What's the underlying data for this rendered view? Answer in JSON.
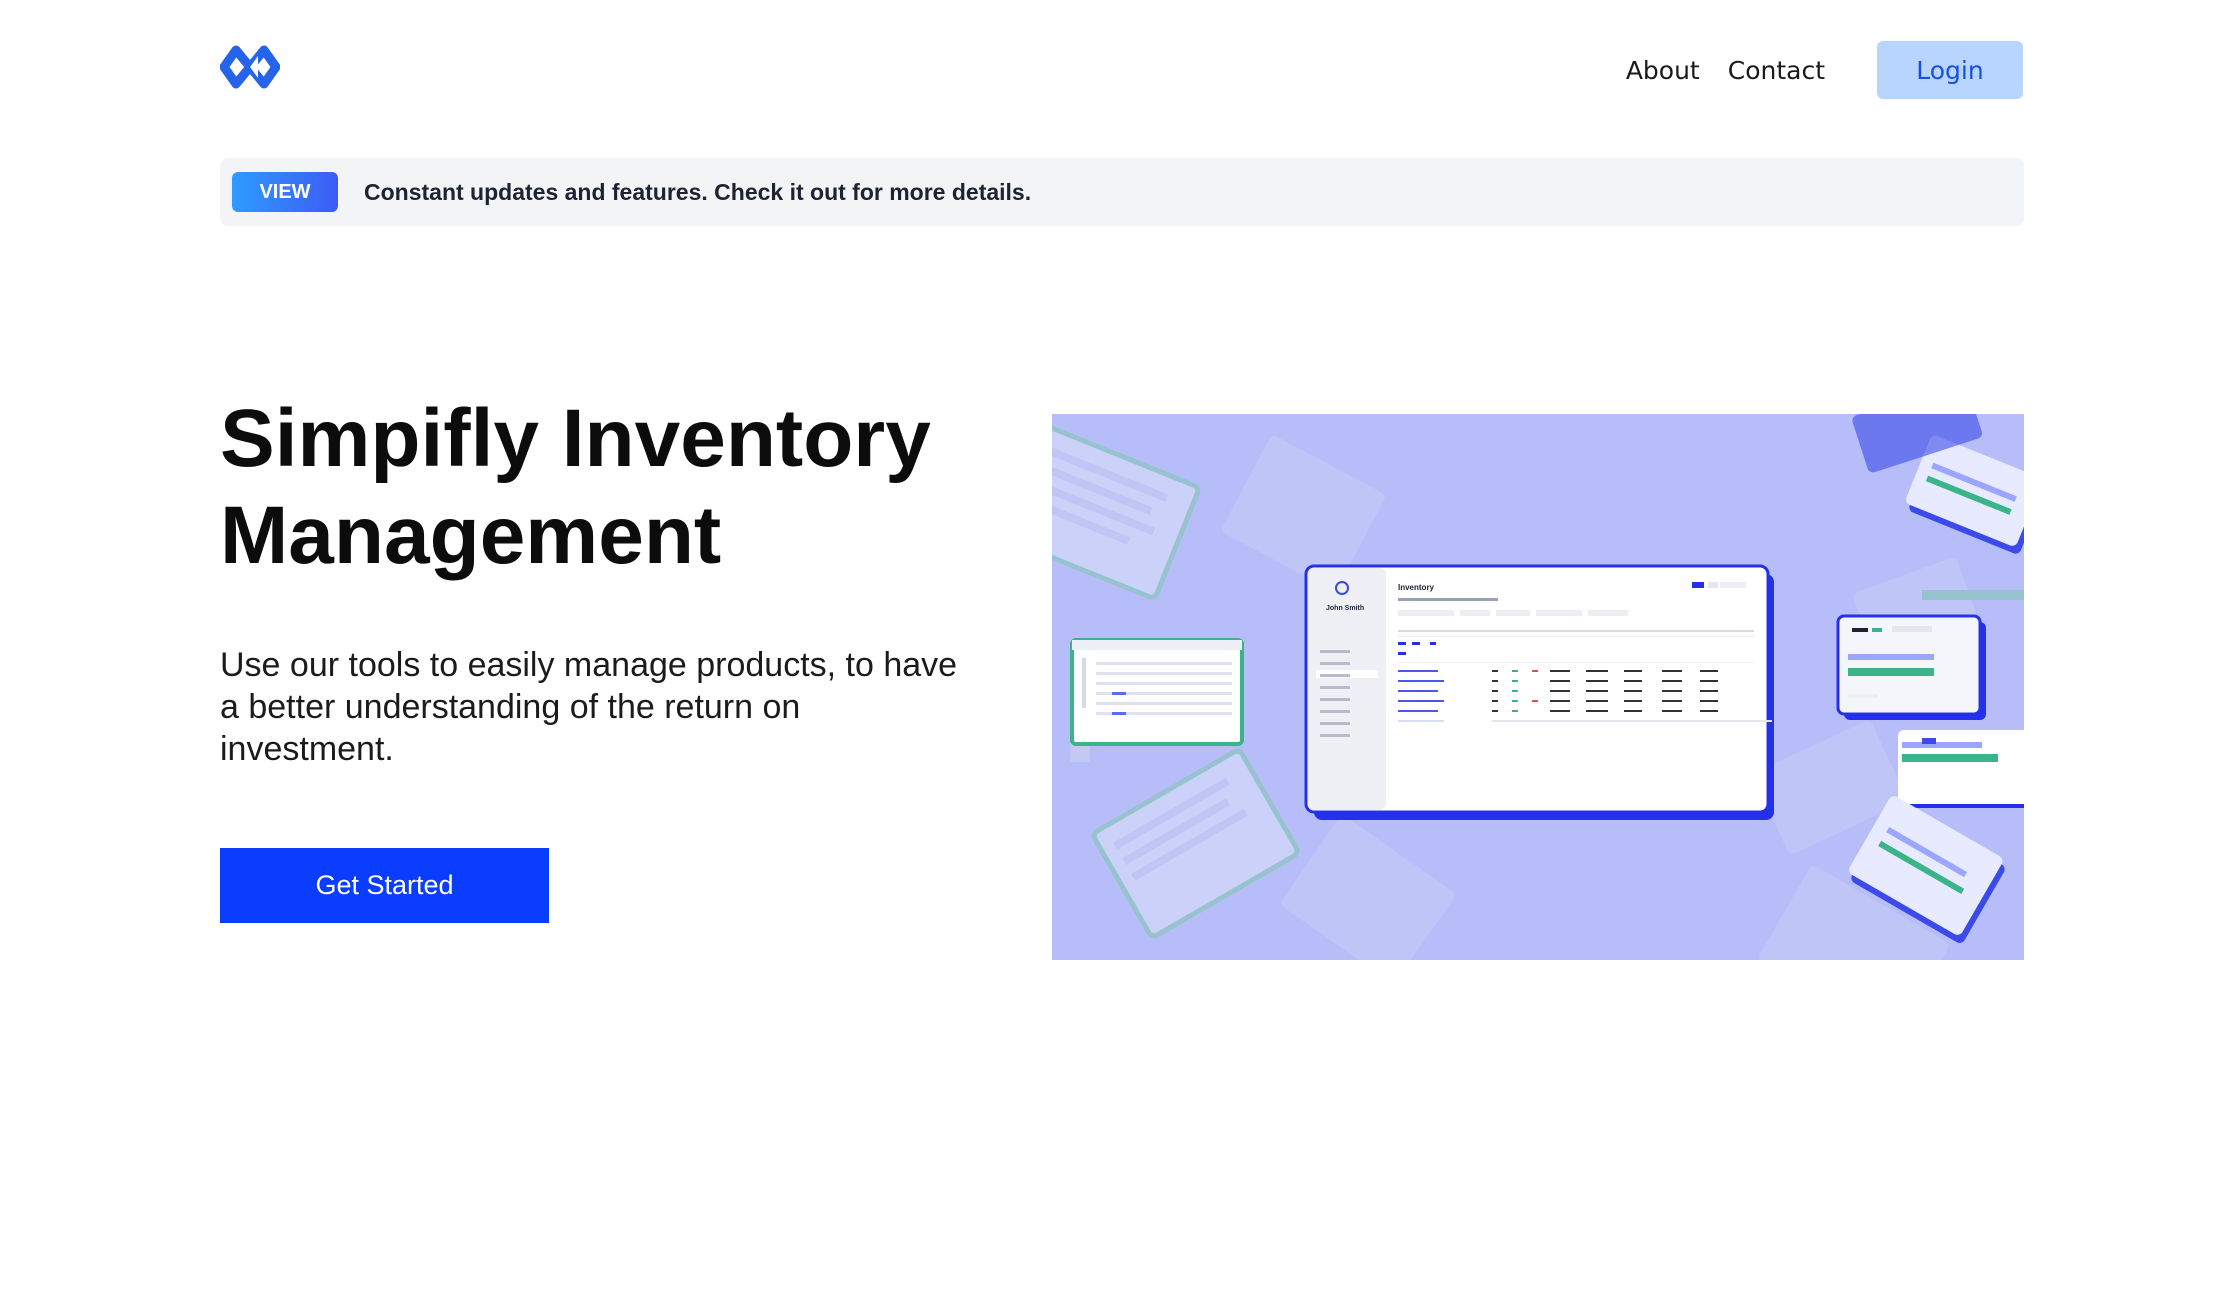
{
  "nav": {
    "about": "About",
    "contact": "Contact",
    "login": "Login"
  },
  "banner": {
    "badge": "VIEW",
    "text": "Constant updates and features. Check it out for more details."
  },
  "hero": {
    "title": "Simpifly Inventory Management",
    "subtitle": "Use our tools to easily manage products, to have a better understanding of the return on investment.",
    "cta": "Get Started"
  },
  "illustration": {
    "panel_title": "Inventory",
    "user_name": "John Smith"
  },
  "colors": {
    "brand_blue": "#0a3dff",
    "login_bg": "#b8d5ff",
    "illustration_bg": "#b7bdf8",
    "accent_green": "#3bb48a"
  },
  "icons": [
    "logo-icon"
  ]
}
